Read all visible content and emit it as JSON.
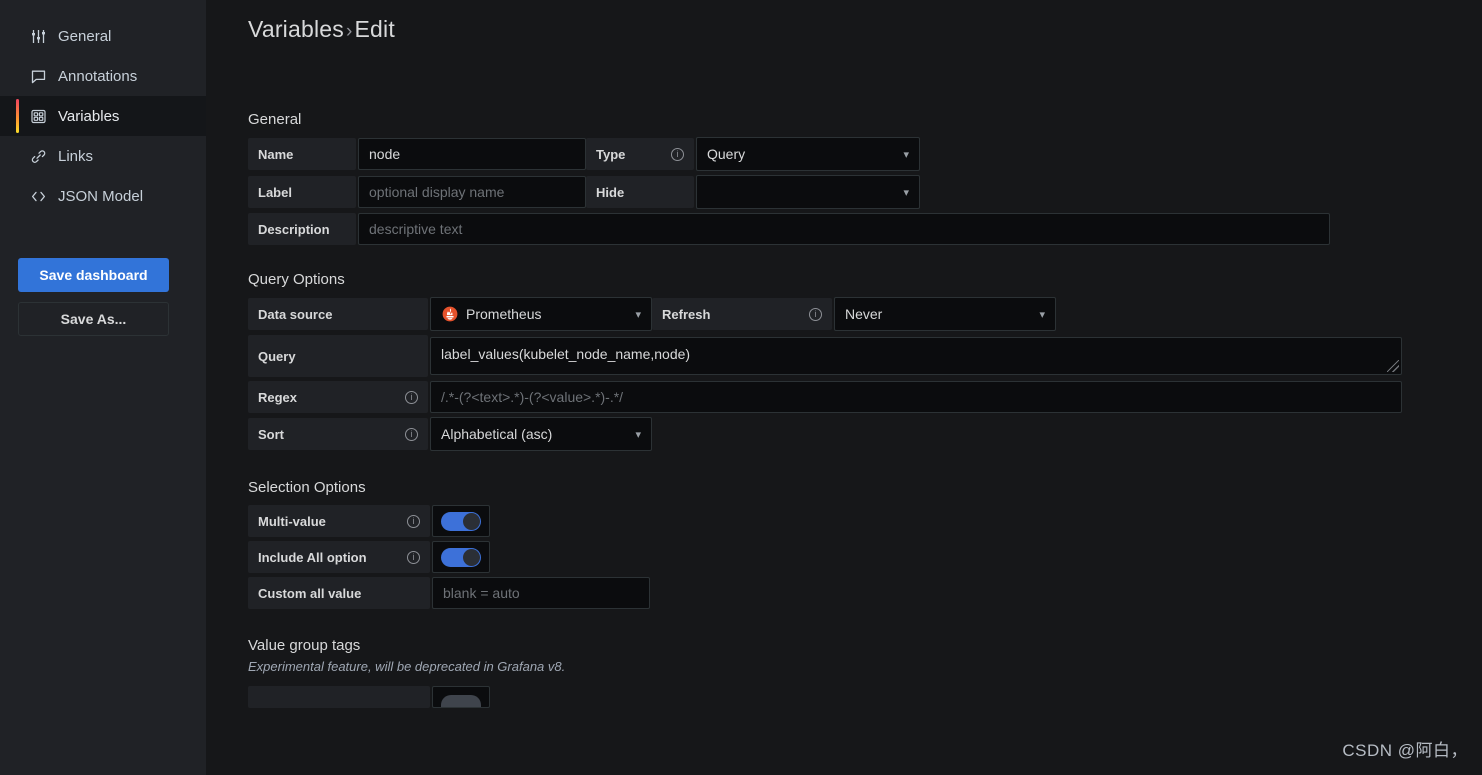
{
  "sidebar": {
    "items": [
      {
        "label": "General",
        "icon": "sliders-icon",
        "active": false
      },
      {
        "label": "Annotations",
        "icon": "comment-icon",
        "active": false
      },
      {
        "label": "Variables",
        "icon": "grid-table-icon",
        "active": true
      },
      {
        "label": "Links",
        "icon": "link-chain-icon",
        "active": false
      },
      {
        "label": "JSON Model",
        "icon": "code-brackets-icon",
        "active": false
      }
    ],
    "save_dashboard_label": "Save dashboard",
    "save_as_label": "Save As..."
  },
  "header": {
    "breadcrumb_root": "Variables",
    "breadcrumb_sep": "›",
    "breadcrumb_current": "Edit"
  },
  "general": {
    "section_title": "General",
    "name_label": "Name",
    "name_value": "node",
    "type_label": "Type",
    "type_value": "Query",
    "label_label": "Label",
    "label_placeholder": "optional display name",
    "hide_label": "Hide",
    "hide_value": "",
    "description_label": "Description",
    "description_placeholder": "descriptive text"
  },
  "query_options": {
    "section_title": "Query Options",
    "datasource_label": "Data source",
    "datasource_value": "Prometheus",
    "datasource_icon": "prometheus-icon",
    "refresh_label": "Refresh",
    "refresh_value": "Never",
    "query_label": "Query",
    "query_value": "label_values(kubelet_node_name,node)",
    "regex_label": "Regex",
    "regex_placeholder": "/.*-(?<text>.*)-(?<value>.*)-.*/",
    "sort_label": "Sort",
    "sort_value": "Alphabetical (asc)"
  },
  "selection_options": {
    "section_title": "Selection Options",
    "multi_value_label": "Multi-value",
    "multi_value_on": true,
    "include_all_label": "Include All option",
    "include_all_on": true,
    "custom_all_label": "Custom all value",
    "custom_all_placeholder": "blank = auto"
  },
  "value_group_tags": {
    "section_title": "Value group tags",
    "section_note": "Experimental feature, will be deprecated in Grafana v8."
  },
  "watermark": {
    "text": "CSDN @阿白，"
  },
  "colors": {
    "accent_blue": "#3274d9",
    "toggle_on": "#3d71d9",
    "prometheus_orange": "#e6522c",
    "panel_bg": "#161719",
    "sidebar_bg": "#202226",
    "field_bg": "#0b0c0e",
    "label_bg": "#202226",
    "active_bar": "#f2495c"
  }
}
